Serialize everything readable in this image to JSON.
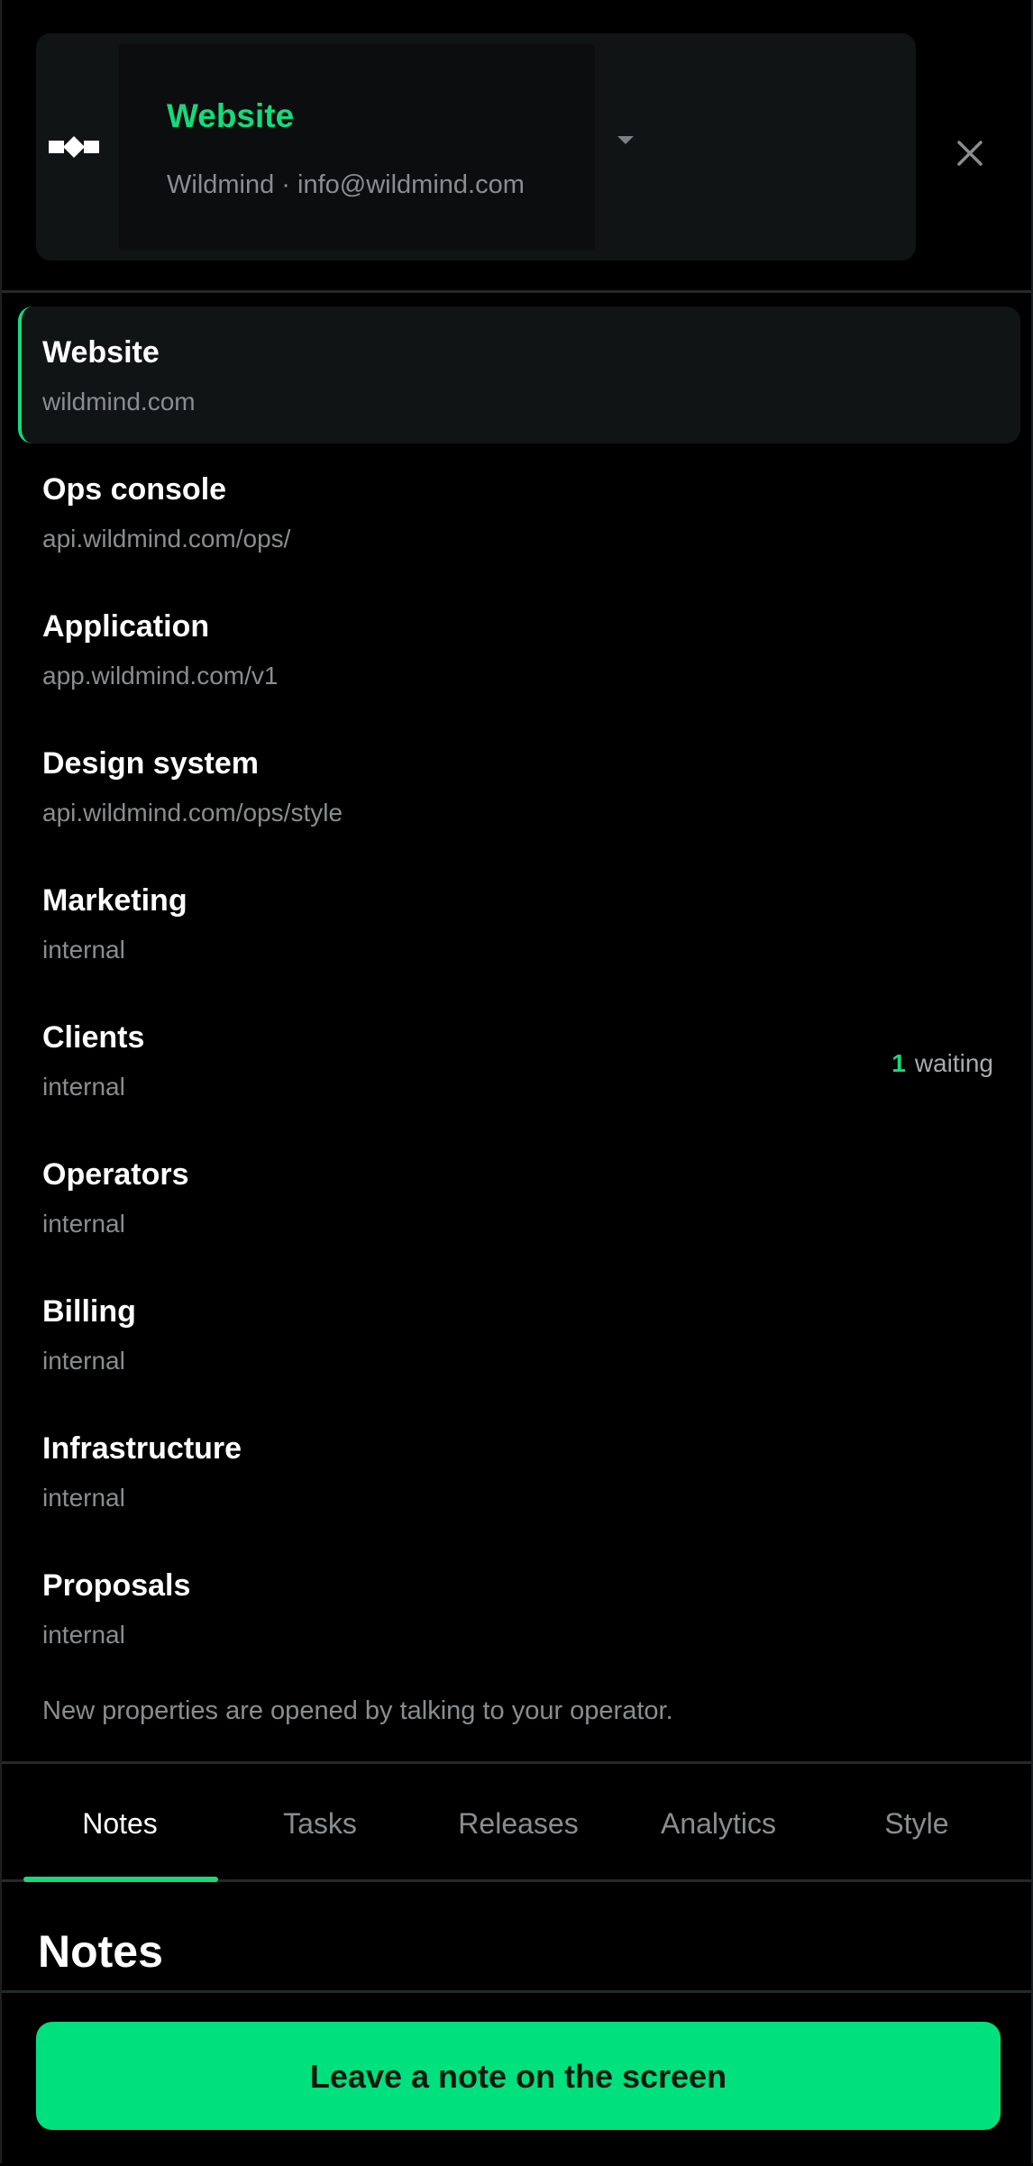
{
  "header": {
    "property_name": "Website",
    "property_sub": "Wildmind · info@wildmind.com",
    "logo_icon": "wildmind-logo-icon",
    "dropdown_icon": "caret-down-icon",
    "close_icon": "close-icon"
  },
  "properties": [
    {
      "title": "Website",
      "subtitle": "wildmind.com",
      "active": true
    },
    {
      "title": "Ops console",
      "subtitle": "api.wildmind.com/ops/"
    },
    {
      "title": "Application",
      "subtitle": "app.wildmind.com/v1"
    },
    {
      "title": "Design system",
      "subtitle": "api.wildmind.com/ops/style"
    },
    {
      "title": "Marketing",
      "subtitle": "internal"
    },
    {
      "title": "Clients",
      "subtitle": "internal",
      "waiting_count": "1",
      "waiting_label": "waiting"
    },
    {
      "title": "Operators",
      "subtitle": "internal"
    },
    {
      "title": "Billing",
      "subtitle": "internal"
    },
    {
      "title": "Infrastructure",
      "subtitle": "internal"
    },
    {
      "title": "Proposals",
      "subtitle": "internal"
    }
  ],
  "footnote": "New properties are opened by talking to your operator.",
  "tabs": [
    {
      "label": "Notes",
      "active": true
    },
    {
      "label": "Tasks"
    },
    {
      "label": "Releases"
    },
    {
      "label": "Analytics"
    },
    {
      "label": "Style"
    }
  ],
  "section": {
    "title": "Notes",
    "cta_label": "Leave a note on the screen"
  },
  "colors": {
    "accent": "#17d97a",
    "cta": "#00e07d",
    "background": "#000000",
    "card": "#111415"
  }
}
